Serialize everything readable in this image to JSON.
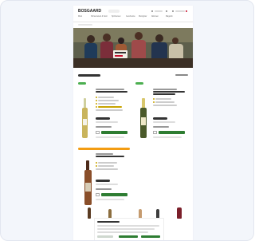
{
  "header": {
    "logo_main": "BOSGAARD",
    "logo_sub": "",
    "nav_items": [
      "Wein",
      "Schaumwein & Sekt",
      "Spirituosen",
      "Geschenke",
      "Weingüter",
      "Aktionen",
      "Magazin"
    ]
  },
  "main": {
    "section_title": "Wein im Shop",
    "sort_label": "Sortieren"
  },
  "products": [
    {
      "bottle_color": "#c9b45c"
    },
    {
      "bottle_color": "#4a5a2a"
    },
    {
      "bottle_color": "#8a4f2a"
    }
  ],
  "colors": {
    "brand": "#c8102e",
    "cta": "#2e7d32",
    "badge": "#f39c12",
    "tag": "#4caf50"
  },
  "cookie_banner": {
    "title": "Cookie-Einstellungen"
  },
  "icons": [
    "search-icon",
    "user-icon",
    "cart-icon",
    "heart-icon"
  ]
}
